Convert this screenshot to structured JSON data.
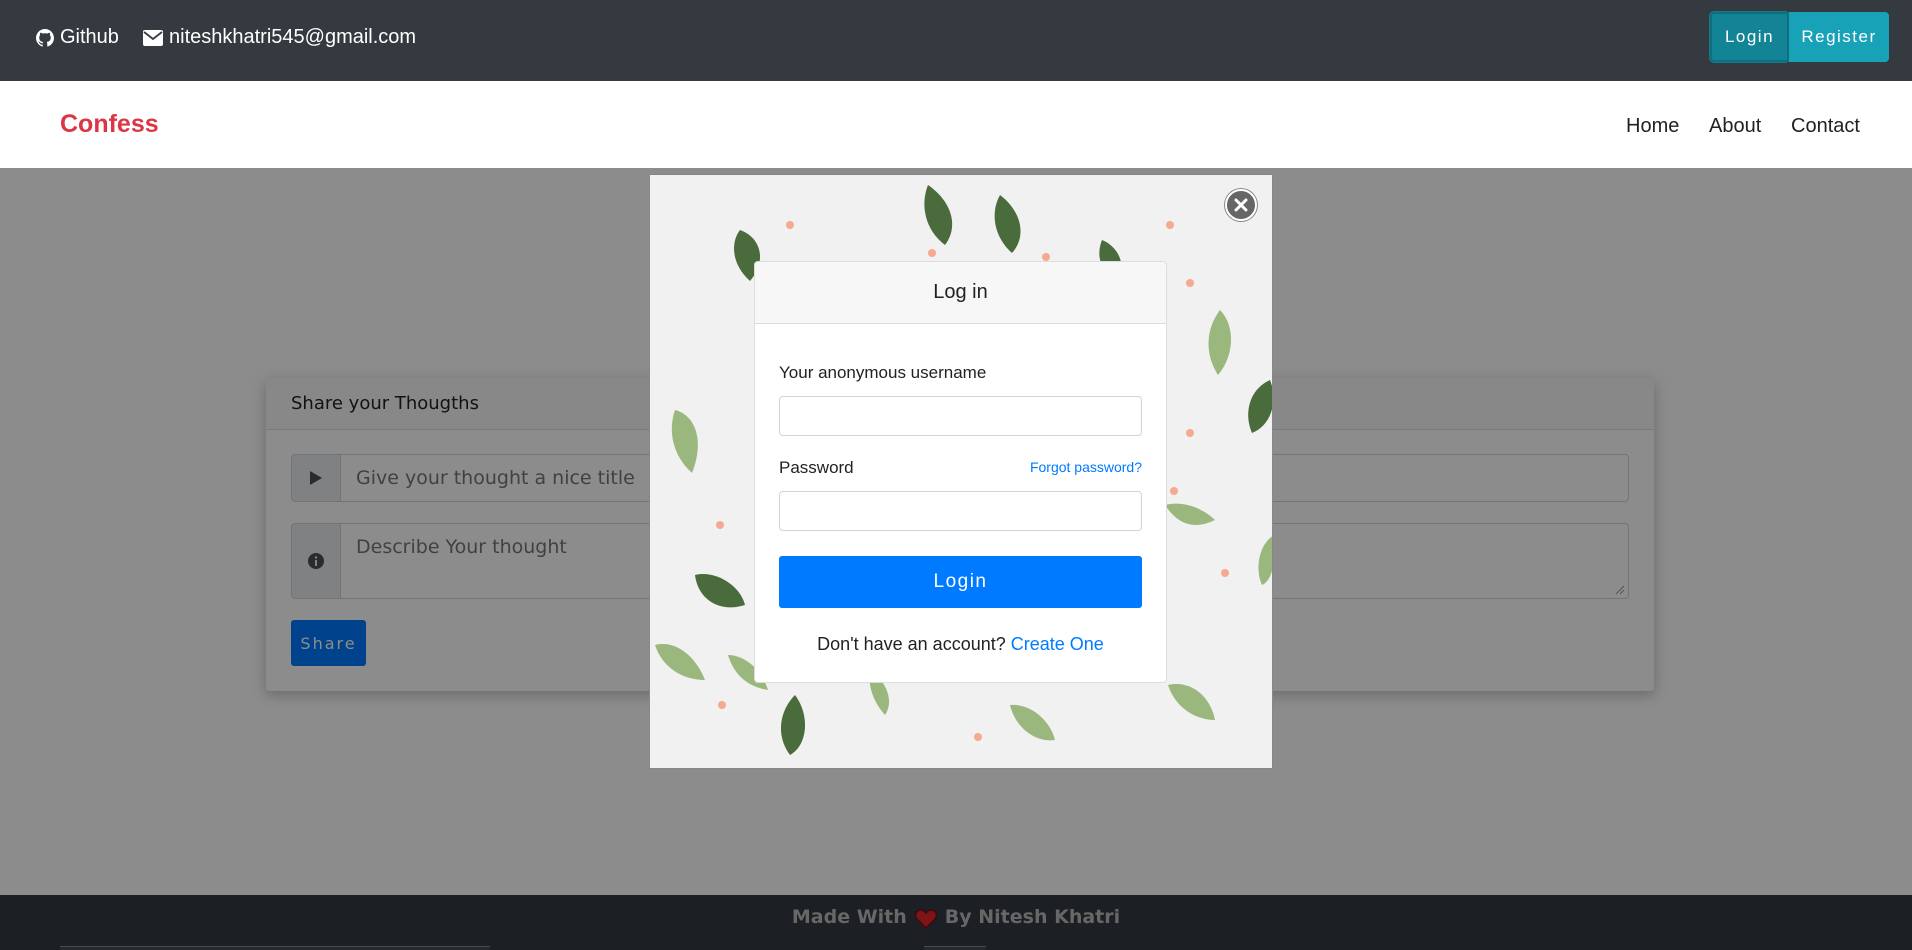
{
  "topbar": {
    "github_label": "Github",
    "email_label": "niteshkhatri545@gmail.com",
    "login_label": "Login",
    "register_label": "Register"
  },
  "navbar": {
    "brand": "Confess",
    "links": [
      "Home",
      "About",
      "Contact"
    ]
  },
  "share_card": {
    "header": "Share your Thougths",
    "title_placeholder": "Give your thought a nice title",
    "description_placeholder": "Describe Your thought",
    "share_label": "Share"
  },
  "footer": {
    "made_with": "Made With",
    "by": "By Nitesh Khatri"
  },
  "login_modal": {
    "title": "Log in",
    "username_label": "Your anonymous username",
    "password_label": "Password",
    "forgot_label": "Forgot password?",
    "login_label": "Login",
    "no_account_text": "Don't have an account?",
    "create_label": "Create One"
  },
  "colors": {
    "topbar_bg": "#343a40",
    "brand": "#dc3545",
    "accent_blue": "#007bff",
    "info": "#17a2b8"
  }
}
